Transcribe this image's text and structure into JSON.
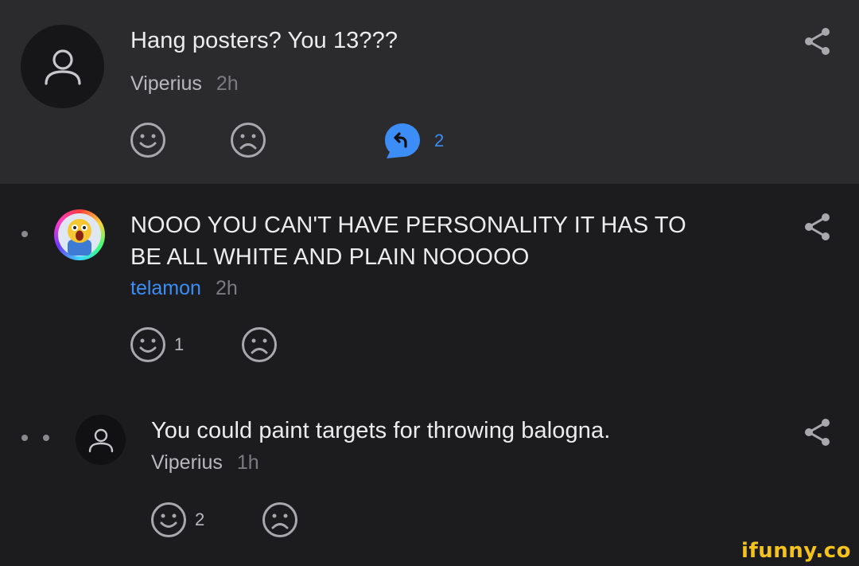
{
  "comments": [
    {
      "text": "Hang posters? You 13???",
      "username": "Viperius",
      "time": "2h",
      "smile_count": "",
      "frown_count": "",
      "reply_count": "2"
    },
    {
      "text_line1": "NOOO YOU CAN'T HAVE PERSONALITY IT HAS TO",
      "text_line2": "BE ALL WHITE AND PLAIN NOOOOO",
      "username": "telamon",
      "time": "2h",
      "smile_count": "1",
      "frown_count": ""
    },
    {
      "text": "You could paint targets for throwing balogna.",
      "username": "Viperius",
      "time": "1h",
      "smile_count": "2",
      "frown_count": ""
    }
  ],
  "watermark": "ifunny.co",
  "colors": {
    "top_comment_bg": "#2b2b2e",
    "page_bg": "#1c1c1f",
    "accent_blue": "#3c8df6",
    "watermark_yellow": "#f4c21d"
  }
}
